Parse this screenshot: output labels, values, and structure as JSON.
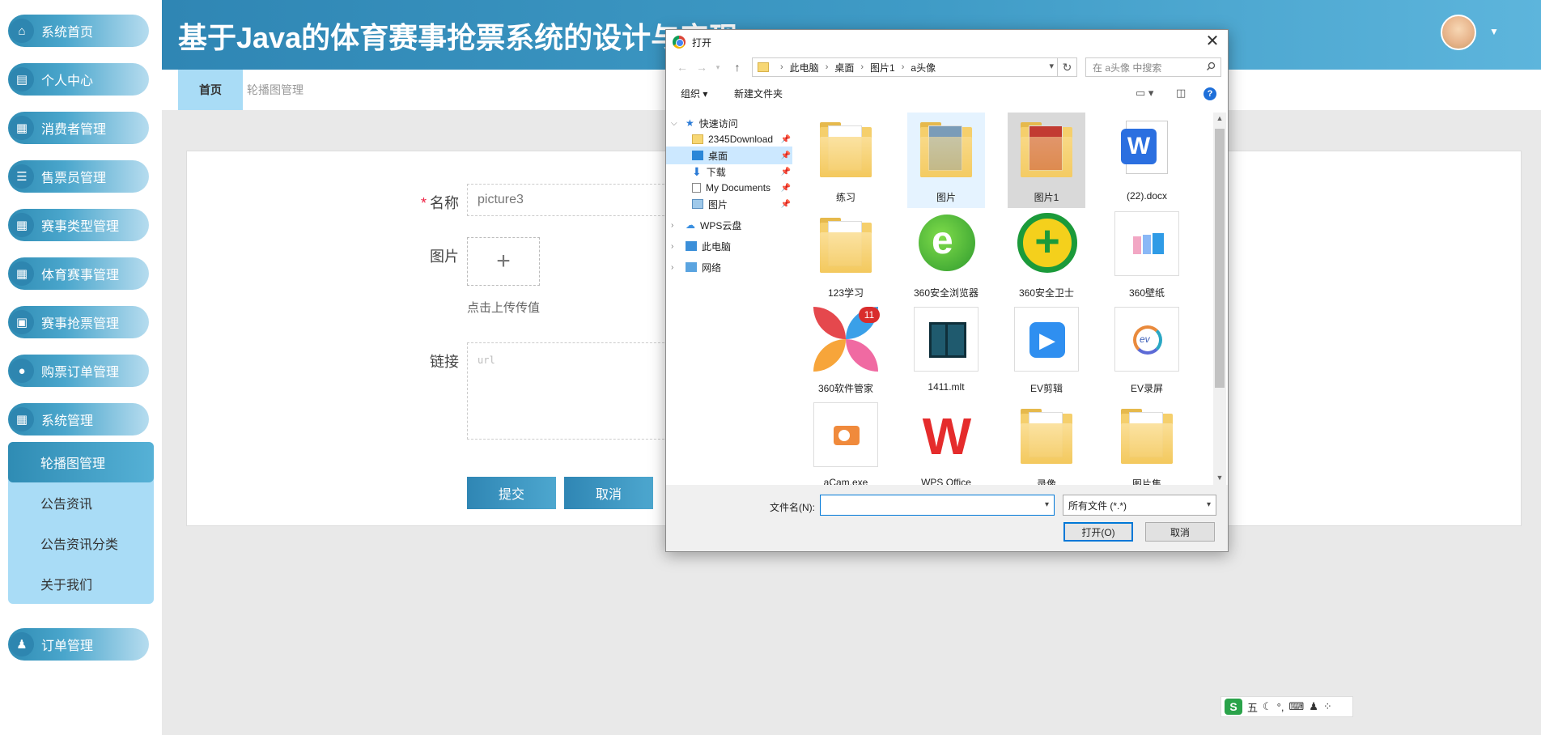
{
  "app": {
    "title": "基于Java的体育赛事抢票系统的设计与实现"
  },
  "sidebar": {
    "items": [
      {
        "label": "系统首页",
        "icon": "home-icon"
      },
      {
        "label": "个人中心",
        "icon": "profile-icon"
      },
      {
        "label": "消费者管理",
        "icon": "grid-icon"
      },
      {
        "label": "售票员管理",
        "icon": "sliders-icon"
      },
      {
        "label": "赛事类型管理",
        "icon": "grid-icon"
      },
      {
        "label": "体育赛事管理",
        "icon": "grid-icon"
      },
      {
        "label": "赛事抢票管理",
        "icon": "ticket-icon"
      },
      {
        "label": "购票订单管理",
        "icon": "bulb-icon"
      },
      {
        "label": "系统管理",
        "icon": "grid-icon"
      }
    ],
    "submenu": [
      "轮播图管理",
      "公告资讯",
      "公告资讯分类",
      "关于我们"
    ],
    "order_item": {
      "label": "订单管理",
      "icon": "user-icon"
    }
  },
  "tabs": {
    "home": "首页",
    "carousel": "轮播图管理"
  },
  "form": {
    "name_label": "名称",
    "name_value": "picture3",
    "image_label": "图片",
    "upload_plus": "+",
    "upload_hint": "点击上传传值",
    "link_label": "链接",
    "link_placeholder": "url",
    "submit": "提交",
    "cancel": "取消"
  },
  "dialog": {
    "title": "打开",
    "close": "✕",
    "breadcrumb": [
      "此电脑",
      "桌面",
      "图片1",
      "a头像"
    ],
    "search_placeholder": "在 a头像 中搜索",
    "organize": "组织 ▾",
    "new_folder": "新建文件夹",
    "tree": [
      {
        "label": "快速访问",
        "type": "star"
      },
      {
        "label": "2345Download",
        "type": "folder"
      },
      {
        "label": "桌面",
        "type": "desktop"
      },
      {
        "label": "下载",
        "type": "download"
      },
      {
        "label": "My Documents",
        "type": "doc"
      },
      {
        "label": "图片",
        "type": "pic"
      },
      {
        "label": "WPS云盘",
        "type": "cloud"
      },
      {
        "label": "此电脑",
        "type": "pc"
      },
      {
        "label": "网络",
        "type": "net"
      }
    ],
    "files": [
      {
        "name": "练习",
        "kind": "folder"
      },
      {
        "name": "图片",
        "kind": "folder"
      },
      {
        "name": "图片1",
        "kind": "folder"
      },
      {
        "name": "(22).docx",
        "kind": "docx"
      },
      {
        "name": "123学习",
        "kind": "folder"
      },
      {
        "name": "360安全浏览器",
        "kind": "ie"
      },
      {
        "name": "360安全卫士",
        "kind": "guard"
      },
      {
        "name": "360壁纸",
        "kind": "wallpaper"
      },
      {
        "name": "360软件管家",
        "kind": "softmgr"
      },
      {
        "name": "1411.mlt",
        "kind": "mlt"
      },
      {
        "name": "EV剪辑",
        "kind": "evclip"
      },
      {
        "name": "EV录屏",
        "kind": "evrec"
      },
      {
        "name": "aCam.exe",
        "kind": "acam"
      },
      {
        "name": "WPS Office",
        "kind": "wps"
      },
      {
        "name": "录像",
        "kind": "folder"
      },
      {
        "name": "图片集",
        "kind": "folder"
      }
    ],
    "badge_count": "11",
    "filename_label": "文件名(N):",
    "filename_value": "",
    "filetype": "所有文件 (*.*)",
    "open": "打开(O)",
    "cancel": "取消"
  },
  "ime": {
    "logo": "S",
    "mode": "五"
  }
}
